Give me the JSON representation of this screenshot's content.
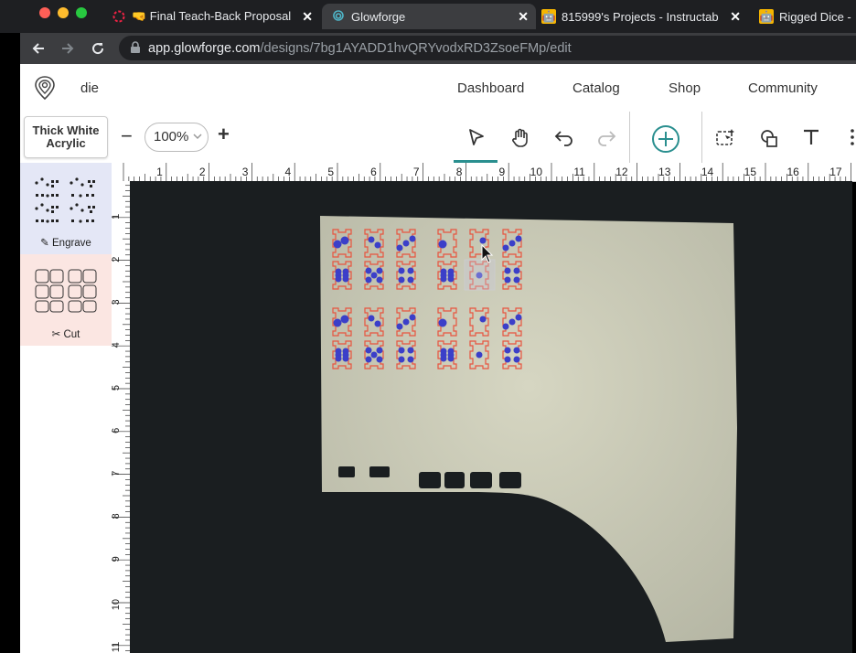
{
  "browser": {
    "tabs": [
      {
        "label": "🤜 Final Teach-Back Proposal"
      },
      {
        "label": "Glowforge"
      },
      {
        "label": "815999's Projects - Instructab"
      },
      {
        "label": "Rigged Dice -"
      }
    ],
    "url_host": "app.glowforge.com",
    "url_path": "/designs/7bg1AYADD1hvQRYvodxRD3ZsoeFMp/edit"
  },
  "app": {
    "design_name": "die",
    "nav": [
      "Dashboard",
      "Catalog",
      "Shop",
      "Community"
    ]
  },
  "toolbar": {
    "material_line1": "Thick White",
    "material_line2": "Acrylic",
    "zoom": "100%",
    "zoom_out": "−",
    "zoom_in": "+"
  },
  "steps": [
    {
      "label": "Engrave"
    },
    {
      "label": "Cut"
    }
  ],
  "ruler": {
    "top": [
      "1",
      "2",
      "3",
      "4",
      "5",
      "6",
      "7",
      "8",
      "9",
      "10",
      "11",
      "12",
      "13",
      "14",
      "15",
      "16",
      "17"
    ],
    "left": [
      "1",
      "2",
      "3",
      "4",
      "5",
      "6",
      "7",
      "8",
      "9",
      "10",
      "11"
    ]
  },
  "colors": {
    "accent": "#2a8f8f",
    "cut": "#e8543f",
    "engrave": "#3b3fc9"
  }
}
